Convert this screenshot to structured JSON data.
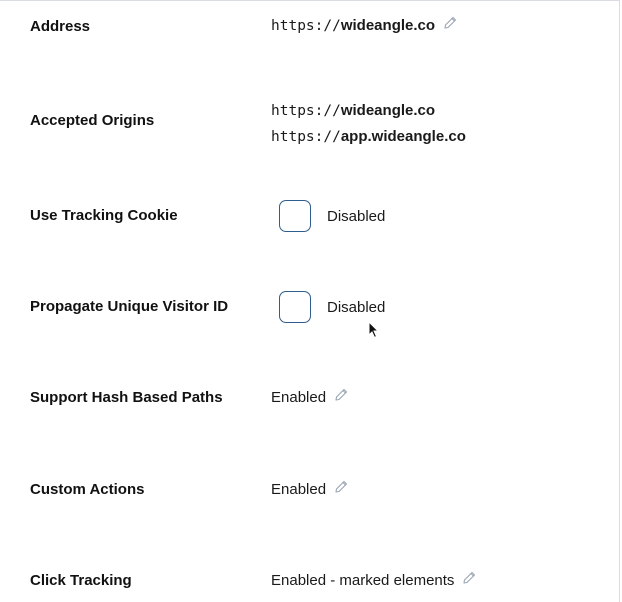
{
  "settings": {
    "address": {
      "label": "Address",
      "scheme": "https://",
      "host": "wideangle.co"
    },
    "accepted_origins": {
      "label": "Accepted Origins",
      "origins": [
        {
          "scheme": "https://",
          "host": "wideangle.co"
        },
        {
          "scheme": "https://",
          "host": "app.wideangle.co"
        }
      ]
    },
    "use_tracking_cookie": {
      "label": "Use Tracking Cookie",
      "status": "Disabled"
    },
    "propagate_visitor_id": {
      "label": "Propagate Unique Visitor ID",
      "status": "Disabled"
    },
    "hash_based_paths": {
      "label": "Support Hash Based Paths",
      "status": "Enabled"
    },
    "custom_actions": {
      "label": "Custom Actions",
      "status": "Enabled"
    },
    "click_tracking": {
      "label": "Click Tracking",
      "status": "Enabled - marked elements"
    }
  },
  "icons": {
    "edit": "pencil-icon",
    "cursor": "mouse-pointer-icon"
  },
  "colors": {
    "checkbox_border": "#2f5e8c",
    "pencil": "#9aa6b2",
    "panel_border": "#d9dde3"
  }
}
